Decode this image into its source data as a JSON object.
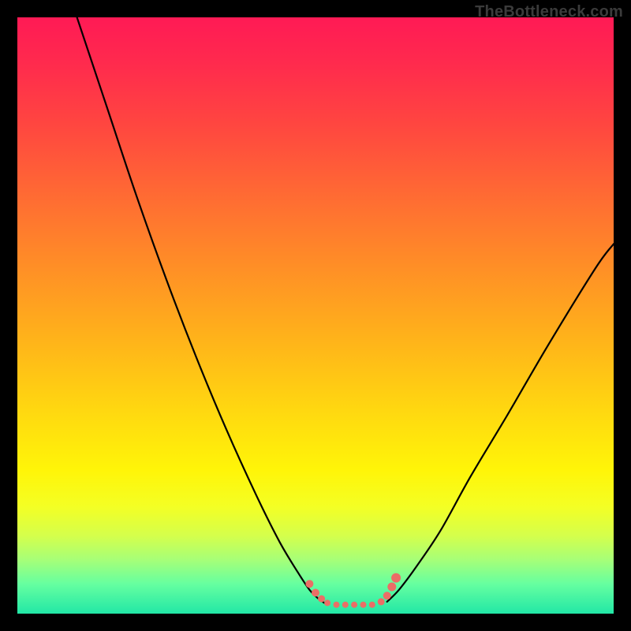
{
  "watermark": "TheBottleneck.com",
  "colors": {
    "frame": "#000000",
    "gradient_top": "#ff1a55",
    "gradient_mid": "#ffd810",
    "gradient_bottom": "#22e7a6",
    "curve": "#000000",
    "markers": "#eb6e66"
  },
  "chart_data": {
    "type": "line",
    "title": "",
    "xlabel": "",
    "ylabel": "",
    "xlim": [
      0,
      100
    ],
    "ylim": [
      0,
      100
    ],
    "grid": false,
    "legend": false,
    "series": [
      {
        "name": "left-branch",
        "x": [
          10,
          15,
          20,
          25,
          30,
          35,
          40,
          44,
          47,
          49,
          50.5,
          51.5
        ],
        "y": [
          100,
          85,
          70,
          56,
          43,
          31,
          20,
          12,
          7,
          4,
          2.5,
          1.8
        ]
      },
      {
        "name": "right-branch",
        "x": [
          62,
          64,
          67,
          71,
          76,
          82,
          89,
          97,
          100
        ],
        "y": [
          2,
          4,
          8,
          14,
          23,
          33,
          45,
          58,
          62
        ]
      },
      {
        "name": "markers",
        "x": [
          49,
          50,
          51,
          52,
          53.5,
          55,
          56.5,
          58,
          59.5,
          61,
          62,
          62.8,
          63.5
        ],
        "y": [
          5,
          3.5,
          2.5,
          1.8,
          1.5,
          1.5,
          1.5,
          1.5,
          1.5,
          2,
          3,
          4.5,
          6
        ],
        "r": [
          5,
          5,
          4.5,
          4,
          4,
          4,
          4,
          4,
          4,
          4.5,
          5,
          5.5,
          6
        ]
      }
    ]
  }
}
